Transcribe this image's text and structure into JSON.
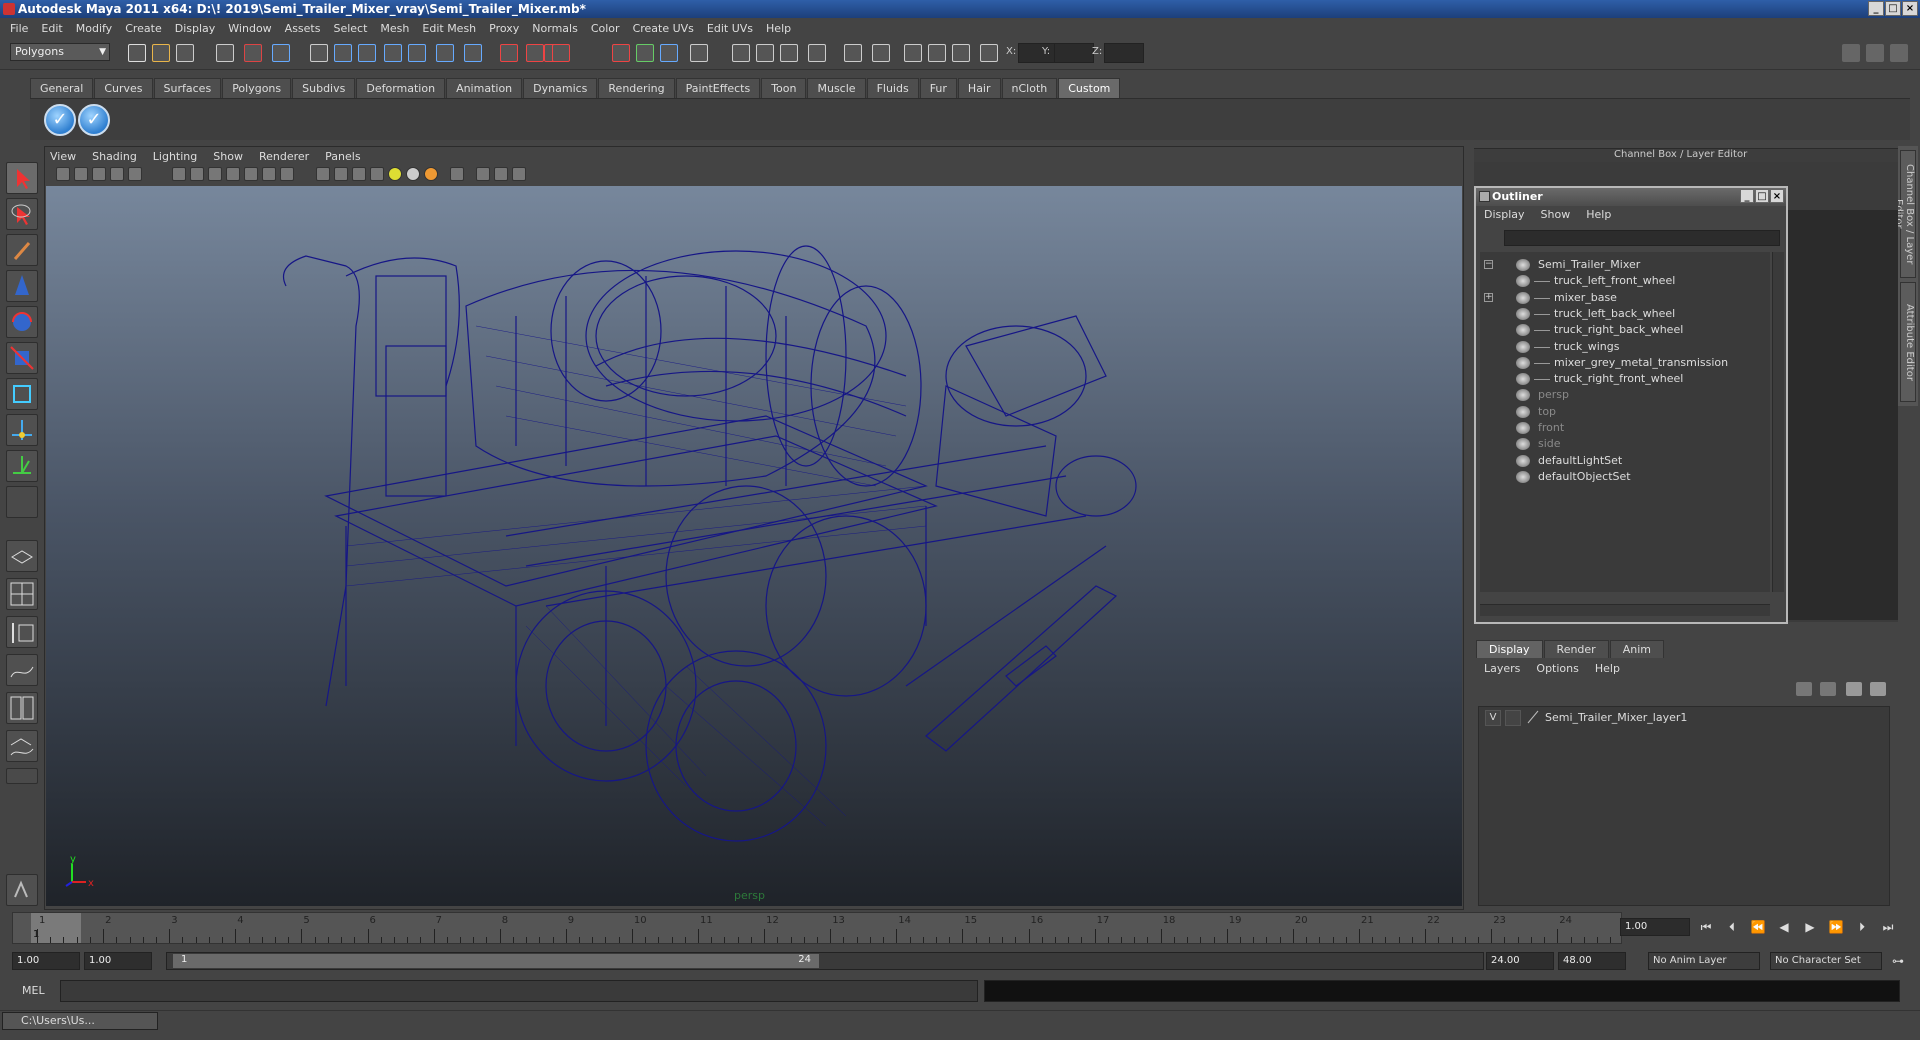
{
  "window": {
    "title": "Autodesk Maya 2011 x64: D:\\! 2019\\Semi_Trailer_Mixer_vray\\Semi_Trailer_Mixer.mb*"
  },
  "menubar": [
    "File",
    "Edit",
    "Modify",
    "Create",
    "Display",
    "Window",
    "Assets",
    "Select",
    "Mesh",
    "Edit Mesh",
    "Proxy",
    "Normals",
    "Color",
    "Create UVs",
    "Edit UVs",
    "Help"
  ],
  "status": {
    "mode": "Polygons",
    "x_label": "X:",
    "y_label": "Y:",
    "z_label": "Z:"
  },
  "shelf": {
    "tabs": [
      "General",
      "Curves",
      "Surfaces",
      "Polygons",
      "Subdivs",
      "Deformation",
      "Animation",
      "Dynamics",
      "Rendering",
      "PaintEffects",
      "Toon",
      "Muscle",
      "Fluids",
      "Fur",
      "Hair",
      "nCloth",
      "Custom"
    ],
    "active_tab": "Custom"
  },
  "viewport": {
    "menu": [
      "View",
      "Shading",
      "Lighting",
      "Show",
      "Renderer",
      "Panels"
    ],
    "camera_label": "persp",
    "wire_color": "#161686"
  },
  "channel_box": {
    "header": "Channel Box / Layer Editor",
    "side_tabs": [
      "Channel Box / Layer Editor",
      "Attribute Editor"
    ]
  },
  "outliner": {
    "title": "Outliner",
    "menu": [
      "Display",
      "Show",
      "Help"
    ],
    "items": [
      {
        "label": "Semi_Trailer_Mixer",
        "depth": 0,
        "dim": false
      },
      {
        "label": "truck_left_front_wheel",
        "depth": 1,
        "dim": false
      },
      {
        "label": "mixer_base",
        "depth": 1,
        "dim": false
      },
      {
        "label": "truck_left_back_wheel",
        "depth": 1,
        "dim": false
      },
      {
        "label": "truck_right_back_wheel",
        "depth": 1,
        "dim": false
      },
      {
        "label": "truck_wings",
        "depth": 1,
        "dim": false
      },
      {
        "label": "mixer_grey_metal_transmission",
        "depth": 1,
        "dim": false
      },
      {
        "label": "truck_right_front_wheel",
        "depth": 1,
        "dim": false
      },
      {
        "label": "persp",
        "depth": 0,
        "dim": true
      },
      {
        "label": "top",
        "depth": 0,
        "dim": true
      },
      {
        "label": "front",
        "depth": 0,
        "dim": true
      },
      {
        "label": "side",
        "depth": 0,
        "dim": true
      },
      {
        "label": "defaultLightSet",
        "depth": 0,
        "dim": false
      },
      {
        "label": "defaultObjectSet",
        "depth": 0,
        "dim": false
      }
    ]
  },
  "layer_editor": {
    "tabs": [
      "Display",
      "Render",
      "Anim"
    ],
    "active_tab": "Display",
    "menu": [
      "Layers",
      "Options",
      "Help"
    ],
    "layer": {
      "visible": "V",
      "name": "Semi_Trailer_Mixer_layer1"
    }
  },
  "timeline": {
    "ticks": [
      "1",
      "2",
      "3",
      "4",
      "5",
      "6",
      "7",
      "8",
      "9",
      "10",
      "11",
      "12",
      "13",
      "14",
      "15",
      "16",
      "17",
      "18",
      "19",
      "20",
      "21",
      "22",
      "23",
      "24"
    ],
    "current": "1",
    "current_time_field": "1.00"
  },
  "range": {
    "start": "1.00",
    "playback_start": "1.00",
    "slider_start": "1",
    "slider_end": "24",
    "playback_end": "24.00",
    "end": "48.00",
    "anim_layer": "No Anim Layer",
    "character_set": "No Character Set"
  },
  "command": {
    "label": "MEL"
  },
  "taskbar": {
    "item": "C:\\Users\\Us..."
  }
}
